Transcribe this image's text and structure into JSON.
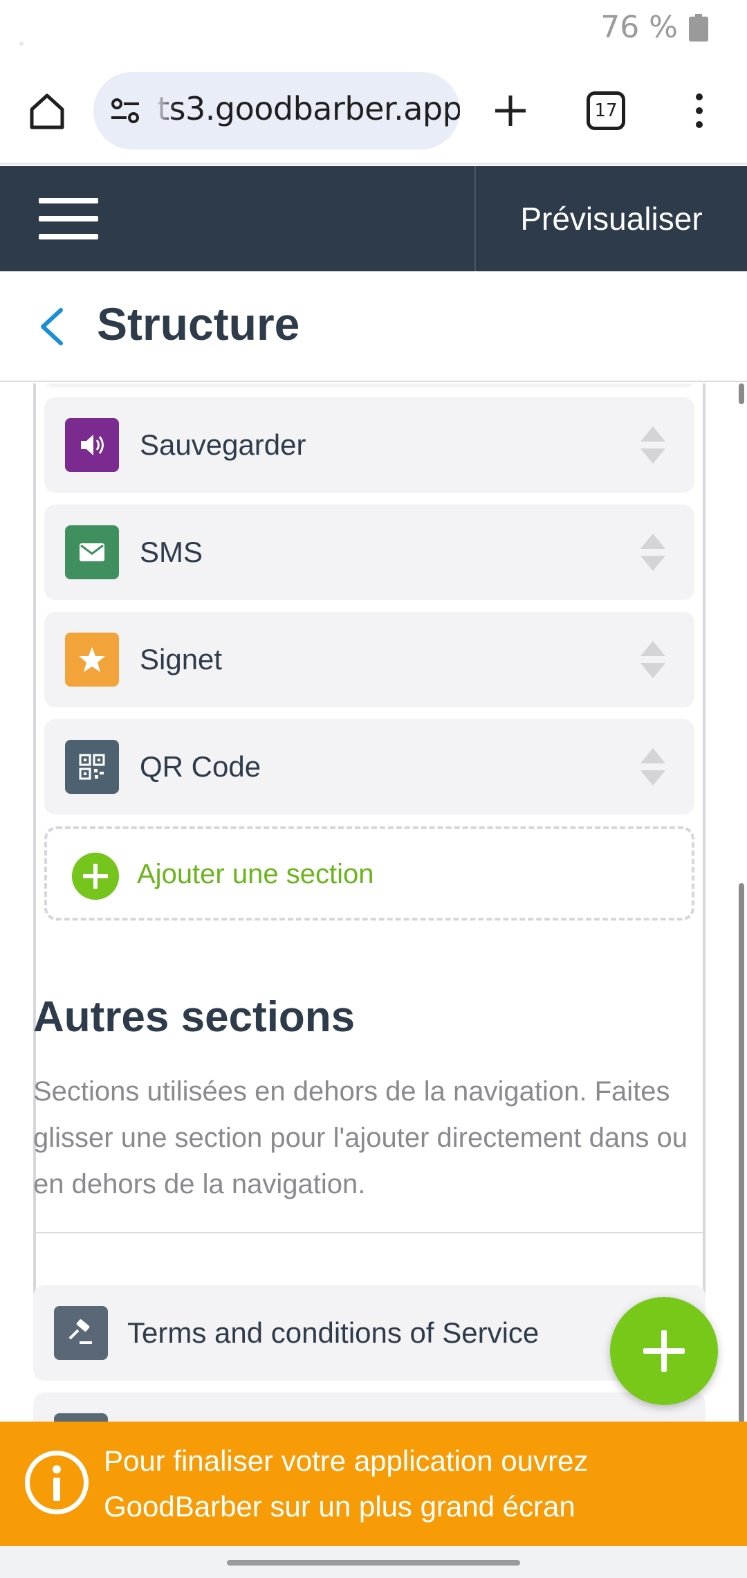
{
  "status_bar": {
    "battery": "76 %"
  },
  "browser": {
    "url": "ts3.goodbarber.app",
    "tab_count": "17"
  },
  "app_header": {
    "preview_label": "Prévisualiser"
  },
  "page": {
    "title": "Structure"
  },
  "nav_sections": [
    {
      "label": "Sauvegarder",
      "icon": "speaker-icon",
      "color": "#7b2a8f"
    },
    {
      "label": "SMS",
      "icon": "envelope-icon",
      "color": "#3f8f5f"
    },
    {
      "label": "Signet",
      "icon": "star-icon",
      "color": "#f2a33a"
    },
    {
      "label": "QR Code",
      "icon": "qr-code-icon",
      "color": "#4e6170"
    }
  ],
  "add_section_label": "Ajouter une section",
  "autres": {
    "title": "Autres sections",
    "description": "Sections utilisées en dehors de la navigation. Faites glisser une section pour l'ajouter directement dans ou en dehors de la navigation."
  },
  "other_sections": [
    {
      "label": "Terms and conditions of Service",
      "icon": "gavel-icon"
    },
    {
      "label": "",
      "icon": "section-icon"
    }
  ],
  "banner": {
    "text": "Pour finaliser votre application ouvrez GoodBarber sur un plus grand écran"
  },
  "colors": {
    "header_bg": "#2e3b4a",
    "accent_green": "#78c81a",
    "banner_orange": "#f79b06",
    "link_blue": "#1a8fd6"
  }
}
